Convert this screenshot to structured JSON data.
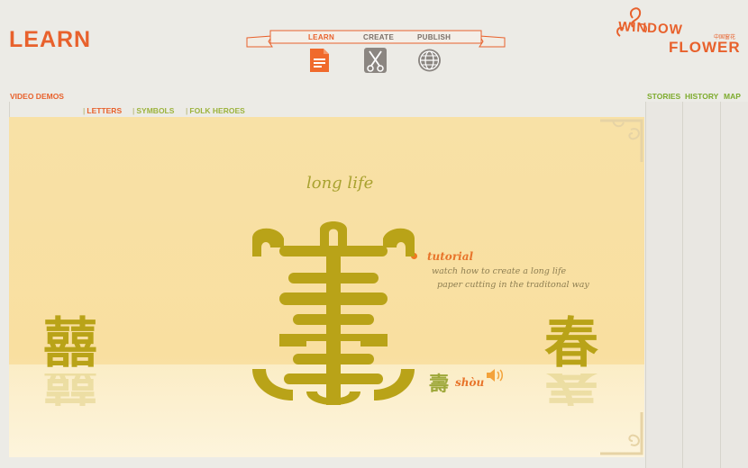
{
  "header": {
    "section_title": "LEARN",
    "nav": [
      {
        "label": "LEARN",
        "icon": "document-icon"
      },
      {
        "label": "CREATE",
        "icon": "scissors-icon"
      },
      {
        "label": "PUBLISH",
        "icon": "globe-icon"
      }
    ],
    "logo": {
      "line1": "WINDOW",
      "line2": "FLOWER",
      "chinese": "中国窗花"
    }
  },
  "left_nav": {
    "video_demos": "VIDEO DEMOS"
  },
  "right_nav": {
    "stories": "STORIES",
    "history": "HISTORY",
    "map": "MAP"
  },
  "subtabs": {
    "letters": "LETTERS",
    "symbols": "SYMBOLS",
    "folk_heroes": "FOLK HEROES"
  },
  "stage": {
    "title": "long life",
    "tutorial": {
      "title": "tutorial",
      "line1": "watch how to create a long life",
      "line2": "paper cutting in the traditonal way"
    },
    "left_character": "囍",
    "right_character": "春",
    "pinyin": "shòu",
    "small_character": "壽"
  },
  "colors": {
    "accent_orange": "#e8612c",
    "green": "#7dab2d",
    "gold": "#b9a318",
    "stage_bg": "#f8e1a6"
  }
}
